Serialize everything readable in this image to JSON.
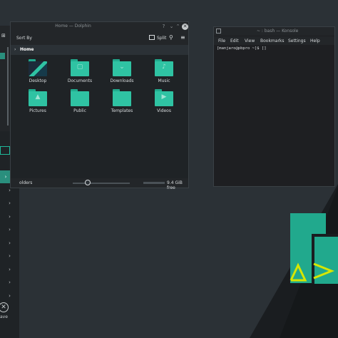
{
  "dolphin": {
    "title": "Home — Dolphin",
    "help_glyph": "?",
    "minimize_glyph": "⌄",
    "maximize_glyph": "⌃",
    "close_glyph": "✕",
    "toolbar": {
      "sort_label": "Sort By",
      "split_label": "Split",
      "search_glyph": "⚲",
      "menu_glyph": "≡"
    },
    "breadcrumb": {
      "chevron": "›",
      "location": "Home"
    },
    "folders": [
      {
        "label": "Desktop",
        "icon": "desktop-folder-icon",
        "glyph": ""
      },
      {
        "label": "Documents",
        "icon": "documents-folder-icon",
        "glyph": "▢"
      },
      {
        "label": "Downloads",
        "icon": "downloads-folder-icon",
        "glyph": "⌄"
      },
      {
        "label": "Music",
        "icon": "music-folder-icon",
        "glyph": "♪"
      },
      {
        "label": "Pictures",
        "icon": "pictures-folder-icon",
        "glyph": "▲"
      },
      {
        "label": "Public",
        "icon": "public-folder-icon",
        "glyph": ""
      },
      {
        "label": "Templates",
        "icon": "templates-folder-icon",
        "glyph": ""
      },
      {
        "label": "Videos",
        "icon": "videos-folder-icon",
        "glyph": "▶"
      }
    ],
    "status": {
      "text": "olders",
      "free": "9.4 GiB free"
    }
  },
  "konsole": {
    "title": "~ : bash — Konsole",
    "menu": [
      "File",
      "Edit",
      "View",
      "Bookmarks",
      "Settings",
      "Help"
    ],
    "prompt": "[manjaro@pbpro ~]$ []"
  },
  "side_panel": {
    "rows": [
      "›",
      "›",
      "›",
      "›",
      "›",
      "›",
      "›",
      "›",
      "›",
      "›"
    ],
    "leave_glyph": "✕",
    "leave_label": "ave"
  },
  "colors": {
    "accent": "#2fc3a3",
    "folder_dark": "#21a98d",
    "logo_green": "#21a98d",
    "logo_yellow": "#d6e600"
  }
}
